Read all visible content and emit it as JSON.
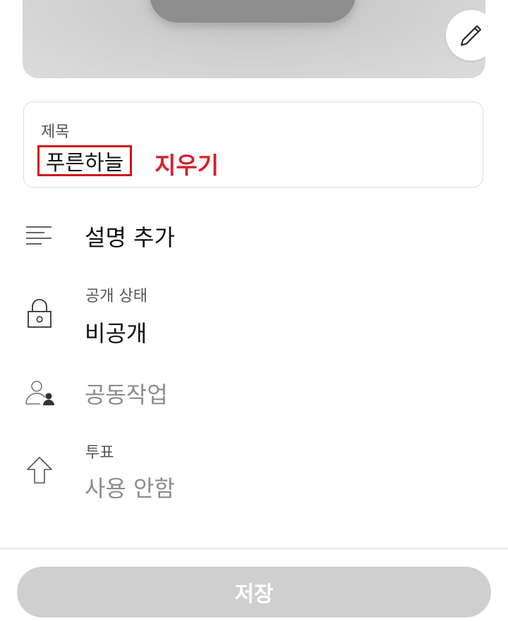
{
  "title_field": {
    "label": "제목",
    "value": "푸른하늘",
    "clear_label": "지우기"
  },
  "description": {
    "label": "설명 추가",
    "icon": "text-lines-icon"
  },
  "visibility": {
    "label": "공개 상태",
    "value": "비공개",
    "icon": "lock-icon"
  },
  "collaboration": {
    "label": "공동작업",
    "icon": "add-person-icon"
  },
  "vote": {
    "label": "투표",
    "value": "사용 안함",
    "icon": "upvote-arrow-icon"
  },
  "thumbnail": {
    "edit_icon": "pencil-icon"
  },
  "save": {
    "label": "저장"
  },
  "colors": {
    "accent_red": "#d6202a",
    "disabled_button": "#cfcfcf"
  }
}
